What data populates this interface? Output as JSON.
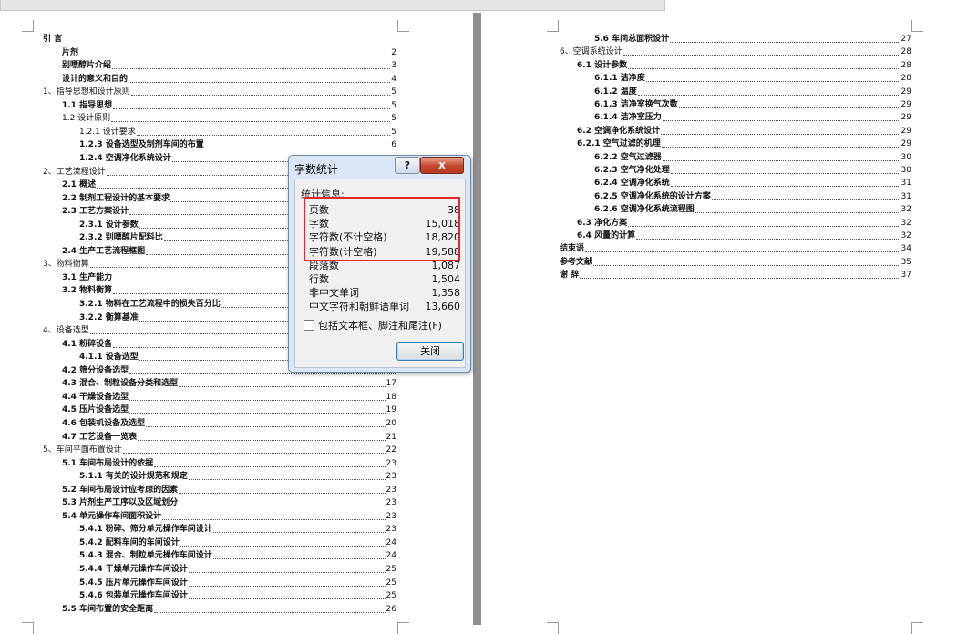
{
  "left_toc": [
    {
      "title": "引   言",
      "page": "",
      "level": 0,
      "bold": true
    },
    {
      "title": "片剂",
      "page": "2",
      "level": 1,
      "bold": true
    },
    {
      "title": "别嘌醇片介绍",
      "page": "3",
      "level": 1,
      "bold": true
    },
    {
      "title": "设计的意义和目的",
      "page": "4",
      "level": 1,
      "bold": true
    },
    {
      "title": "1、指导思想和设计原则",
      "page": "5",
      "level": 0,
      "bold": false
    },
    {
      "title": "1.1  指导思想",
      "page": "5",
      "level": 1,
      "bold": true
    },
    {
      "title": "1.2  设计原则",
      "page": "5",
      "level": 1,
      "bold": false
    },
    {
      "title": "1.2.1 设计要求",
      "page": "5",
      "level": 2,
      "bold": false
    },
    {
      "title": "1.2.3 设备选型及制剂车间的布置",
      "page": "6",
      "level": 2,
      "bold": true
    },
    {
      "title": "1.2.4 空调净化系统设计",
      "page": "",
      "level": 2,
      "bold": true
    },
    {
      "title": "2、工艺流程设计",
      "page": "",
      "level": 0,
      "bold": false
    },
    {
      "title": "2.1 概述",
      "page": "",
      "level": 1,
      "bold": true
    },
    {
      "title": "2.2 制剂工程设计的基本要求",
      "page": "",
      "level": 1,
      "bold": true
    },
    {
      "title": "2.3 工艺方案设计",
      "page": "",
      "level": 1,
      "bold": true
    },
    {
      "title": "2.3.1 设计参数",
      "page": "",
      "level": 2,
      "bold": true
    },
    {
      "title": "2.3.2 别嘌醇片配料比",
      "page": "",
      "level": 2,
      "bold": true
    },
    {
      "title": "2.4 生产工艺流程框图",
      "page": "",
      "level": 1,
      "bold": true
    },
    {
      "title": "3、物料衡算",
      "page": "",
      "level": 0,
      "bold": false
    },
    {
      "title": "3.1  生产能力",
      "page": "",
      "level": 1,
      "bold": true
    },
    {
      "title": "3.2  物料衡算",
      "page": "",
      "level": 1,
      "bold": true
    },
    {
      "title": "3.2.1 物料在工艺流程中的损失百分比",
      "page": "",
      "level": 2,
      "bold": true
    },
    {
      "title": "3.2.2  衡算基准",
      "page": "",
      "level": 2,
      "bold": true
    },
    {
      "title": "4、设备选型",
      "page": "",
      "level": 0,
      "bold": false
    },
    {
      "title": "4.1  粉碎设备",
      "page": "",
      "level": 1,
      "bold": true
    },
    {
      "title": "4.1.1  设备选型",
      "page": "",
      "level": 2,
      "bold": true
    },
    {
      "title": "4.2 筛分设备选型",
      "page": "",
      "level": 1,
      "bold": true
    },
    {
      "title": "4.3 混合、制粒设备分类和选型",
      "page": "17",
      "level": 1,
      "bold": true
    },
    {
      "title": "4.4 干燥设备选型",
      "page": "18",
      "level": 1,
      "bold": true
    },
    {
      "title": "4.5 压片设备选型",
      "page": "19",
      "level": 1,
      "bold": true
    },
    {
      "title": "4.6 包装机设备及选型",
      "page": "20",
      "level": 1,
      "bold": true
    },
    {
      "title": "4.7  工艺设备一览表",
      "page": "21",
      "level": 1,
      "bold": true
    },
    {
      "title": "5、车间平面布置设计",
      "page": "22",
      "level": 0,
      "bold": false
    },
    {
      "title": "5.1  车间布局设计的依据",
      "page": "23",
      "level": 1,
      "bold": true
    },
    {
      "title": "5.1.1 有关的设计规范和规定",
      "page": "23",
      "level": 2,
      "bold": true
    },
    {
      "title": "5.2  车间布局设计应考虑的因素",
      "page": "23",
      "level": 1,
      "bold": true
    },
    {
      "title": "5.3 片剂生产工序以及区域划分",
      "page": "23",
      "level": 1,
      "bold": true
    },
    {
      "title": "5.4  单元操作车间面积设计",
      "page": "23",
      "level": 1,
      "bold": true
    },
    {
      "title": "5.4.1 粉碎、筛分单元操作车间设计",
      "page": "23",
      "level": 2,
      "bold": true
    },
    {
      "title": "5.4.2 配料车间的车间设计",
      "page": "24",
      "level": 2,
      "bold": true
    },
    {
      "title": "5.4.3 混合、制粒单元操作车间设计",
      "page": "24",
      "level": 2,
      "bold": true
    },
    {
      "title": "5.4.4 干燥单元操作车间设计",
      "page": "25",
      "level": 2,
      "bold": true
    },
    {
      "title": "5.4.5 压片单元操作车间设计",
      "page": "25",
      "level": 2,
      "bold": true
    },
    {
      "title": "5.4.6 包装单元操作车间设计",
      "page": "25",
      "level": 2,
      "bold": true
    },
    {
      "title": "5.5  车间布置的安全距离",
      "page": "26",
      "level": 1,
      "bold": true
    }
  ],
  "right_toc": [
    {
      "title": "5.6 车间总面积设计",
      "page": "27",
      "level": 2,
      "bold": true
    },
    {
      "title": "6、空调系统设计",
      "page": "28",
      "level": 0,
      "bold": false
    },
    {
      "title": "6.1  设计参数",
      "page": "28",
      "level": 1,
      "bold": true
    },
    {
      "title": "6.1.1 洁净度",
      "page": "28",
      "level": 2,
      "bold": true
    },
    {
      "title": "6.1.2 温度",
      "page": "29",
      "level": 2,
      "bold": true
    },
    {
      "title": "6.1.3 洁净室换气次数",
      "page": "29",
      "level": 2,
      "bold": true
    },
    {
      "title": "6.1.4 洁净室压力",
      "page": "29",
      "level": 2,
      "bold": true
    },
    {
      "title": "6.2  空调净化系统设计",
      "page": "29",
      "level": 1,
      "bold": true
    },
    {
      "title": "6.2.1  空气过滤的机理",
      "page": "29",
      "level": 1,
      "bold": true
    },
    {
      "title": "6.2.2 空气过滤器",
      "page": "30",
      "level": 2,
      "bold": true
    },
    {
      "title": "6.2.3 空气净化处理",
      "page": "30",
      "level": 2,
      "bold": true
    },
    {
      "title": "6.2.4 空调净化系统",
      "page": "31",
      "level": 2,
      "bold": true
    },
    {
      "title": "6.2.5 空调净化系统的设计方案",
      "page": "31",
      "level": 2,
      "bold": true
    },
    {
      "title": "6.2.6 空调净化系统流程图",
      "page": "32",
      "level": 2,
      "bold": true
    },
    {
      "title": "6.3  净化方案",
      "page": "32",
      "level": 1,
      "bold": true
    },
    {
      "title": "6.4  风量的计算",
      "page": "32",
      "level": 1,
      "bold": true
    },
    {
      "title": "结束语",
      "page": "34",
      "level": 0,
      "bold": true
    },
    {
      "title": "参考文献",
      "page": "35",
      "level": 0,
      "bold": true
    },
    {
      "title": "谢   辞",
      "page": "37",
      "level": 0,
      "bold": true
    }
  ],
  "dialog": {
    "title": "字数统计",
    "help_label": "?",
    "close_label": "x",
    "group_label": "统计信息:",
    "stats": [
      {
        "label": "页数",
        "value": "38"
      },
      {
        "label": "字数",
        "value": "15,018"
      },
      {
        "label": "字符数(不计空格)",
        "value": "18,820"
      },
      {
        "label": "字符数(计空格)",
        "value": "19,588"
      },
      {
        "label": "段落数",
        "value": "1,087"
      },
      {
        "label": "行数",
        "value": "1,504"
      },
      {
        "label": "非中文单词",
        "value": "1,358"
      },
      {
        "label": "中文字符和朝鲜语单词",
        "value": "13,660"
      }
    ],
    "checkbox_label": "包括文本框、脚注和尾注(F)",
    "checkbox_checked": false,
    "ok_label": "关闭"
  },
  "colors": {
    "highlight": "#e02828",
    "gutter": "#8f8f8f",
    "dialog_bg": "#dbe6f4"
  }
}
